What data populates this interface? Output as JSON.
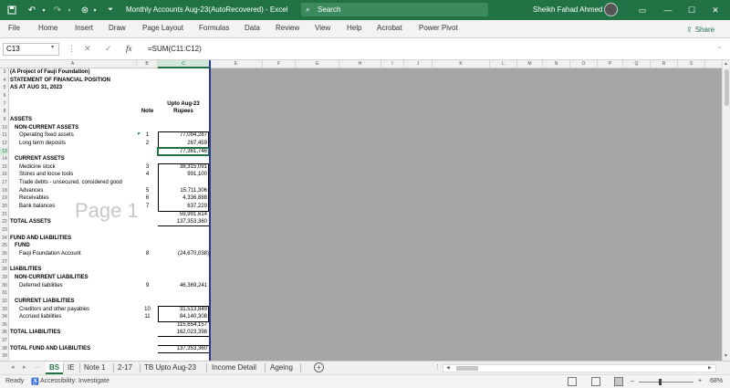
{
  "window": {
    "title": "Monthly Accounts Aug-23(AutoRecovered)  -  Excel",
    "search_placeholder": "Search",
    "user_name": "Sheikh Fahad Ahmed",
    "qat_icons": [
      "save-icon",
      "undo-icon",
      "redo-icon",
      "autosave-icon",
      "customize-icon"
    ],
    "controls": [
      "ribbon-display-icon",
      "minimize-icon",
      "maximize-icon",
      "close-icon"
    ]
  },
  "ribbon": {
    "tabs": [
      "File",
      "Home",
      "Insert",
      "Draw",
      "Page Layout",
      "Formulas",
      "Data",
      "Review",
      "View",
      "Help",
      "Acrobat",
      "Power Pivot"
    ],
    "share_label": "Share"
  },
  "formula_bar": {
    "name_box": "C13",
    "cancel_symbol": "✕",
    "enter_symbol": "✓",
    "fx_symbol": "fx",
    "formula": "=SUM(C11:C12)"
  },
  "grid": {
    "columns": [
      "A",
      "B",
      "C",
      "E",
      "F",
      "G",
      "H",
      "I",
      "J",
      "K",
      "L",
      "M",
      "N",
      "O",
      "P",
      "Q",
      "R",
      "S"
    ],
    "selected_column": "C",
    "rows": [
      "3",
      "4",
      "5",
      "6",
      "7",
      "8",
      "9",
      "10",
      "11",
      "12",
      "13",
      "14",
      "15",
      "16",
      "17",
      "18",
      "19",
      "20",
      "21",
      "22",
      "23",
      "24",
      "25",
      "26",
      "27",
      "28",
      "29",
      "30",
      "31",
      "32",
      "33",
      "34",
      "35",
      "36",
      "37",
      "38",
      "39"
    ],
    "selected_row": "13",
    "watermark": "Page 1"
  },
  "statement": {
    "header1": "(A Project of Fauji Foundation)",
    "header2": "STATEMENT OF FINANCIAL POSITION",
    "header3": "AS AT AUG 31, 2023",
    "col_note": "Note",
    "col_period": "Upto Aug-23",
    "col_unit": "Rupees",
    "assets": "ASSETS",
    "non_current_assets": "NON-CURRENT ASSETS",
    "operating_fixed_assets": "Operating fixed assets",
    "operating_fixed_assets_note": "1",
    "operating_fixed_assets_value": "77,094,287",
    "long_term_deposits": "Long term deposits",
    "long_term_deposits_note": "2",
    "long_term_deposits_value": "267,459",
    "nca_total": "77,361,746",
    "current_assets": "CURRENT ASSETS",
    "medicine_stock": "Medicine stock",
    "medicine_stock_note": "3",
    "medicine_stock_value": "38,315,091",
    "stores_loose_tools": "Stores and loose tools",
    "stores_loose_tools_note": "4",
    "stores_loose_tools_value": "991,100",
    "trade_debts": "Trade debts - unsecured, considered good",
    "advances": "Advances",
    "advances_note": "5",
    "advances_value": "15,711,306",
    "receivables": "Receivables",
    "receivables_note": "6",
    "receivables_value": "4,336,888",
    "bank_balances": "Bank balances",
    "bank_balances_note": "7",
    "bank_balances_value": "637,229",
    "ca_total": "59,991,614",
    "total_assets": "TOTAL ASSETS",
    "total_assets_value": "137,353,360",
    "fund_and_liabilities": "FUND AND LIABILITIES",
    "fund": "FUND",
    "fauji_foundation_account": "Fauji  Foundation Account",
    "fauji_foundation_account_note": "8",
    "fauji_foundation_account_value": "(24,670,038)",
    "liabilities": "LIABILITIES",
    "non_current_liabilities": "NON-CURRENT LIABILITIES",
    "deferred_liabilities": "Deferred liabilities",
    "deferred_liabilities_note": "9",
    "deferred_liabilities_value": "46,369,241",
    "current_liabilities": "CURRENT LIABILITIES",
    "creditors": "Creditors and other payables",
    "creditors_note": "10",
    "creditors_value": "31,513,849",
    "accrued_liabilities": "Accrued liabilities",
    "accrued_liabilities_note": "11",
    "accrued_liabilities_value": "84,140,308",
    "cl_total": "115,654,157",
    "total_liabilities": "TOTAL LIABILITIES",
    "total_liabilities_value": "162,023,398",
    "total_fund_and_liabilities": "TOTAL FUND AND LIABILITIES",
    "total_fund_and_liabilities_value": "137,353,360"
  },
  "sheet_tabs": {
    "items": [
      "BS",
      "IE",
      "Note 1",
      "2-17",
      "TB Upto Aug-23",
      "Income Detail",
      "Ageing"
    ],
    "active": "BS",
    "add_symbol": "+",
    "nav_prev": "◂",
    "nav_next": "▸",
    "nav_more": "…"
  },
  "status": {
    "ready": "Ready",
    "accessibility": "Accessibility: Investigate",
    "zoom": "68%",
    "zoom_minus": "–",
    "zoom_plus": "+"
  },
  "colors": {
    "excel_green": "#217346",
    "page_break": "#2b3a9c",
    "gray_area": "#a6a6a6"
  }
}
